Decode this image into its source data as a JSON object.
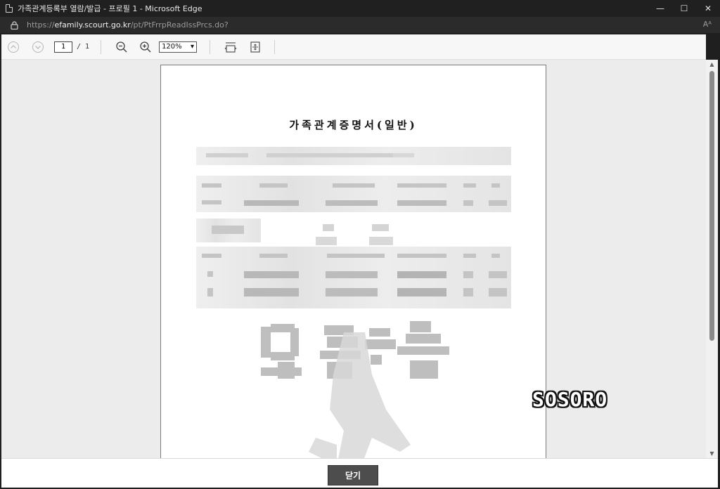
{
  "window": {
    "title": "가족관계등록부 열람/발급 - 프로필 1 - Microsoft Edge",
    "controls": {
      "minimize": "—",
      "maximize": "☐",
      "close": "✕"
    }
  },
  "address": {
    "protocol": "https://",
    "host": "efamily.scourt.go.kr",
    "path": "/pt/PtFrrpReadIssPrcs.do?",
    "read_aloud": "Aᴬ"
  },
  "toolbar": {
    "current_page": "1",
    "page_total": "/ 1",
    "zoom": "120%",
    "zoom_arrow": "▾"
  },
  "document": {
    "title": "가족관계증명서(일반)"
  },
  "footer": {
    "close_label": "닫기"
  },
  "overlay": {
    "watermark": "SOSORO"
  },
  "colors": {
    "titlebar_bg": "#202020",
    "addressbar_bg": "#2b2b2b",
    "viewer_bg": "#ececec",
    "button_bg": "#4d4d4d"
  }
}
